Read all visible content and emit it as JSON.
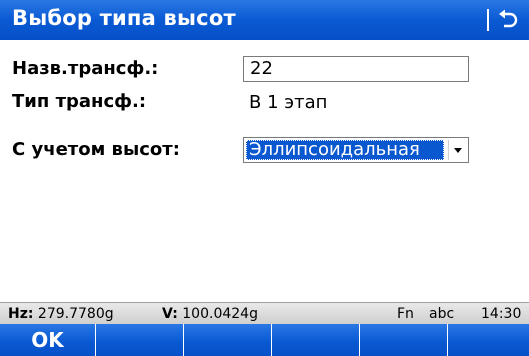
{
  "window": {
    "title": "Выбор типа высот",
    "back_icon": "return-arrow-icon"
  },
  "form": {
    "transform_name": {
      "label": "Назв.трансф.:",
      "value": "22"
    },
    "transform_type": {
      "label": "Тип трансф.:",
      "value": "В 1 этап"
    },
    "height_mode": {
      "label": "С учетом высот:",
      "selected": "Эллипсоидальная"
    }
  },
  "status": {
    "hz_label": "Hz:",
    "hz_value": "279.7780g",
    "v_label": "V:",
    "v_value": "100.0424g",
    "fn": "Fn",
    "input_mode": "abc",
    "time": "14:30"
  },
  "fkeys": [
    "OK",
    "",
    "",
    "",
    "",
    ""
  ],
  "colors": {
    "accent": "#0a5ad4",
    "selection": "#0a58d0"
  }
}
